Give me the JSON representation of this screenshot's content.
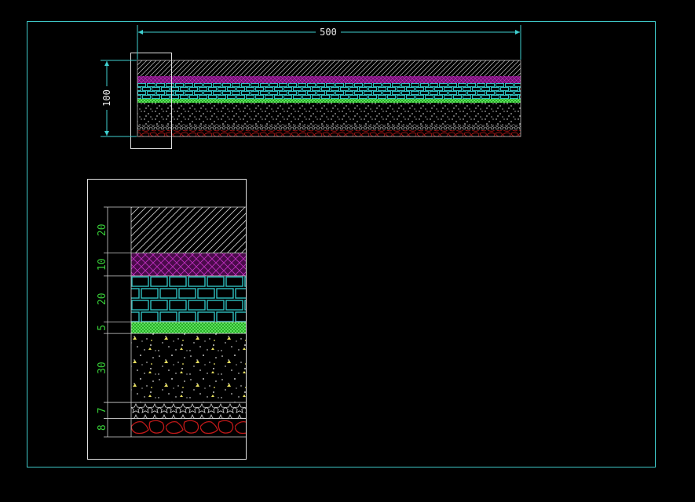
{
  "top_section": {
    "width_label": "500",
    "height_label": "100"
  },
  "detail_section": {
    "layers": [
      {
        "thickness": 20,
        "label": "20",
        "material": "diagonal-hatch"
      },
      {
        "thickness": 10,
        "label": "10",
        "material": "purple-crosshatch"
      },
      {
        "thickness": 20,
        "label": "20",
        "material": "cyan-brick"
      },
      {
        "thickness": 5,
        "label": "5",
        "material": "green-mesh"
      },
      {
        "thickness": 30,
        "label": "30",
        "material": "gravel-concrete"
      },
      {
        "thickness": 7,
        "label": "7",
        "material": "star-pattern"
      },
      {
        "thickness": 8,
        "label": "8",
        "material": "red-stone"
      }
    ]
  },
  "colors": {
    "background": "#000000",
    "frame": "#3fc9c9",
    "dimension": "#3fd0d0",
    "hatch": "#c8c8c8",
    "purple": "#a020a0",
    "brick": "#2fc0c0",
    "mesh": "#3ad23a",
    "gravel_dots": "#ffffff",
    "gravel_specks": "#e8e060",
    "red_stone": "#c01818",
    "detail_label": "#38d038"
  }
}
